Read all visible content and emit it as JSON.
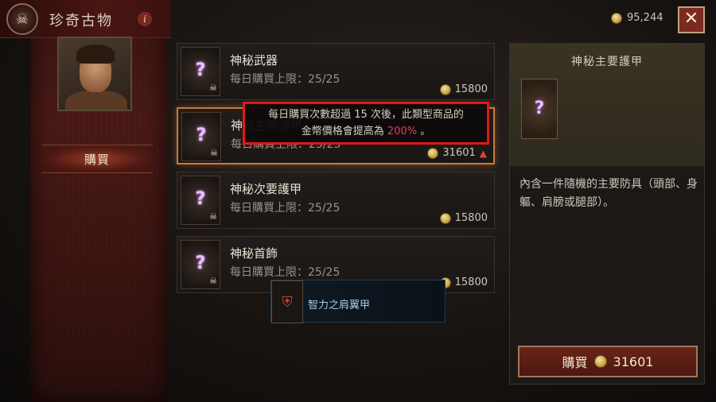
{
  "header": {
    "title": "珍奇古物",
    "info_icon": "i",
    "currency": "95,244",
    "close": "✕"
  },
  "sidebar": {
    "tab_buy": "購買"
  },
  "items": [
    {
      "name": "神秘武器",
      "limit": "每日購買上限：25/25",
      "price": "15800",
      "selected": false
    },
    {
      "name": "神秘主要護甲",
      "limit": "每日購買上限：25/25",
      "price": "31601",
      "selected": true,
      "price_increased": true
    },
    {
      "name": "神秘次要護甲",
      "limit": "每日購買上限：25/25",
      "price": "15800",
      "selected": false
    },
    {
      "name": "神秘首飾",
      "limit": "每日購買上限：25/25",
      "price": "15800",
      "selected": false
    }
  ],
  "tooltip": {
    "line1": "每日購買次數超過 15  次後，此類型商品的",
    "line2a": "金幣價格會提高為 ",
    "percent": "200%",
    "line2b": " 。"
  },
  "hover_item": {
    "label": "智力之肩翼甲"
  },
  "detail": {
    "title": "神秘主要護甲",
    "description": "內含一件隨機的主要防具（頭部、身軀、肩膀或腿部）。",
    "buy_label": "購買",
    "buy_price": "31601"
  },
  "colors": {
    "accent_red": "#e01818",
    "percent_pink": "#e04060",
    "selected_border": "#c87a3a"
  },
  "icons": {
    "emblem": "skull-emblem-icon",
    "item": "question-mark-icon",
    "badge": "skull-icon",
    "coin": "gold-coin-icon",
    "price_up": "red-up-arrow-icon"
  }
}
